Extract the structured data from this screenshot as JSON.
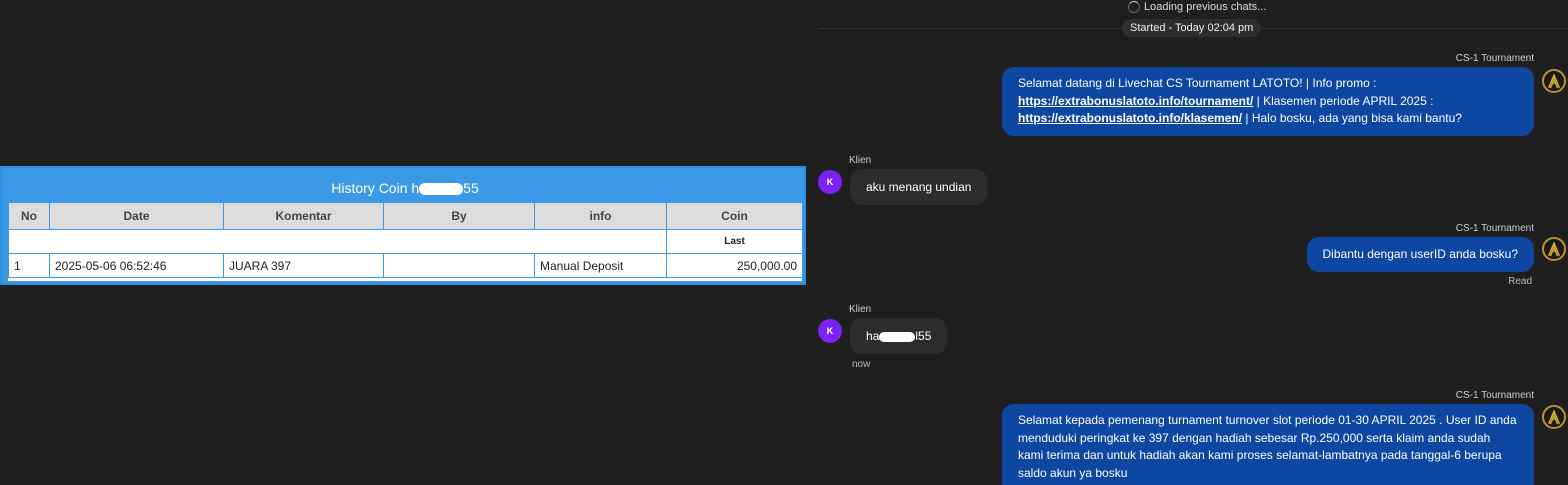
{
  "history": {
    "title_prefix": "History Coin h",
    "title_suffix": "55",
    "columns": [
      "No",
      "Date",
      "Komentar",
      "By",
      "info",
      "Coin"
    ],
    "subheader": "Last",
    "rows": [
      {
        "no": "1",
        "date": "2025-05-06 06:52:46",
        "komentar": "JUARA 397",
        "by": "",
        "info": "Manual Deposit",
        "coin": "250,000.00"
      }
    ]
  },
  "chat": {
    "loading_text": "Loading previous chats...",
    "started_text": "Started - Today 02:04 pm",
    "agent_name": "CS-1 Tournament",
    "client_name": "Klien",
    "client_initial": "K",
    "msg1": {
      "part1": "Selamat datang di Livechat CS Tournament LATOTO! | Info promo :",
      "link1": "https://extrabonuslatoto.info/tournament/",
      "part2": " | Klasemen periode APRIL 2025 :",
      "link2": "https://extrabonuslatoto.info/klasemen/",
      "part3": " | Halo bosku, ada yang bisa kami bantu?"
    },
    "msg2": "aku menang undian",
    "msg3": "Dibantu dengan userID anda bosku?",
    "msg3_status": "Read",
    "msg4_prefix": "ha",
    "msg4_suffix": "l55",
    "msg4_time": "now",
    "msg5": "Selamat kepada pemenang turnament turnover slot periode 01-30 APRIL 2025 . User ID anda menduduki peringkat ke 397 dengan hadiah sebesar Rp.250,000 serta klaim anda sudah kami terima dan untuk hadiah akan kami proses selamat-lambatnya pada tanggal-6 berupa saldo akun ya bosku"
  },
  "colors": {
    "agent_bubble": "#0d47a1",
    "client_bubble": "#2c2c2e",
    "client_avatar": "#7b22f5",
    "table_header": "#3b99e6",
    "amount": "#1c8a1c"
  },
  "icons": {
    "spinner": "loading-spinner-icon",
    "agent_avatar": "agent-logo-icon"
  }
}
